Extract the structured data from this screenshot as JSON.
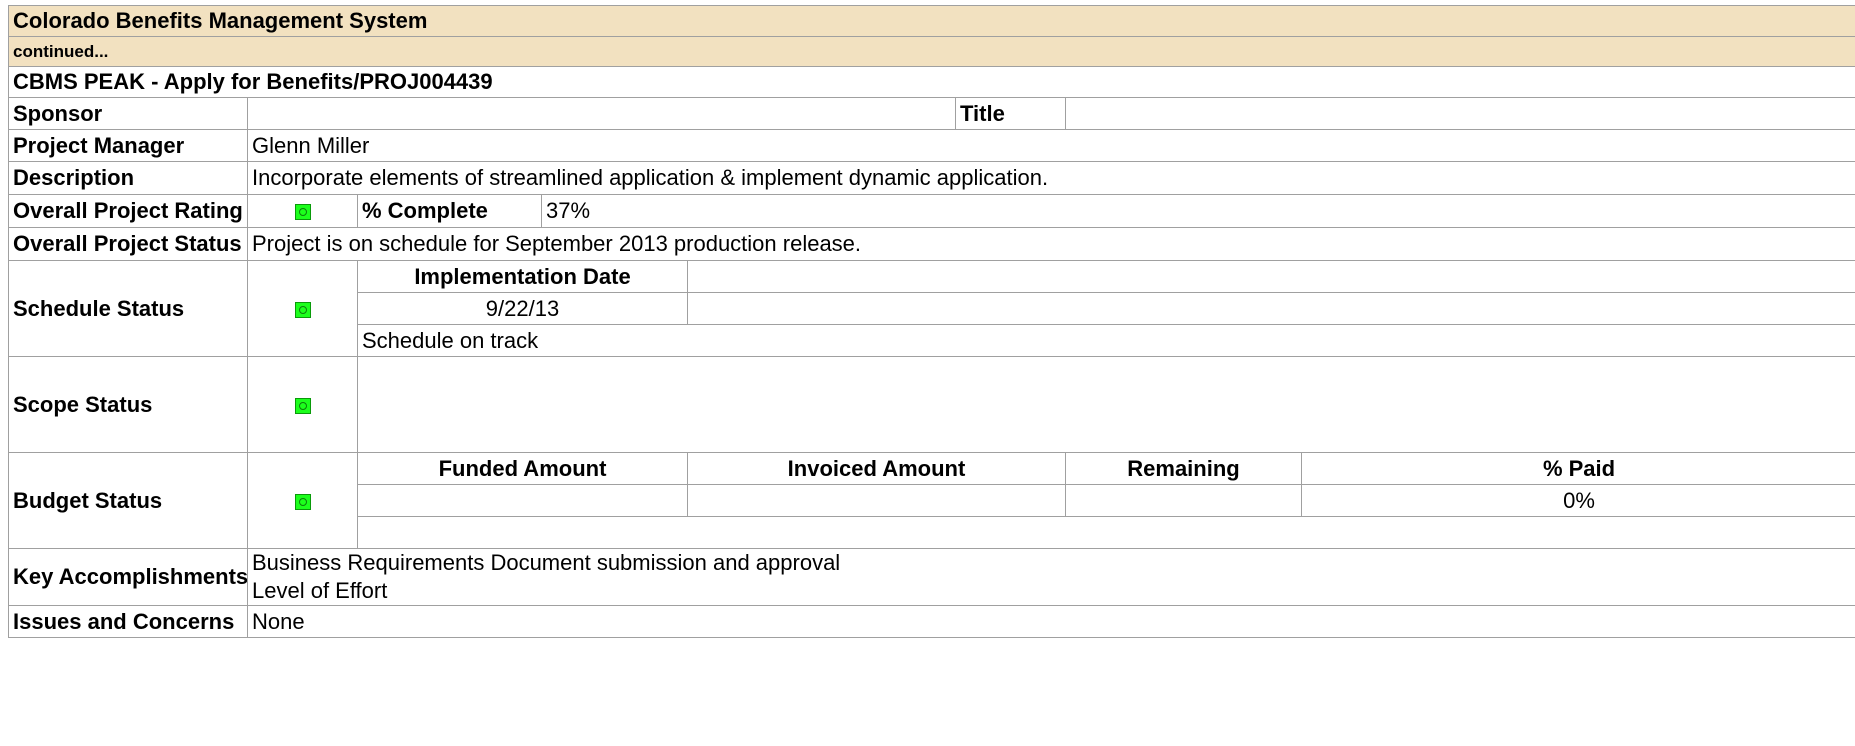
{
  "system_title": "Colorado Benefits Management System",
  "continued": "continued...",
  "project_title": "CBMS PEAK - Apply for Benefits/PROJ004439",
  "labels": {
    "sponsor": "Sponsor",
    "title": "Title",
    "project_manager": "Project Manager",
    "description": "Description",
    "overall_rating": "Overall Project Rating",
    "percent_complete": "% Complete",
    "overall_status": "Overall Project Status",
    "schedule_status": "Schedule Status",
    "implementation_date": "Implementation Date",
    "scope_status": "Scope Status",
    "budget_status": "Budget Status",
    "funded_amount": "Funded Amount",
    "invoiced_amount": "Invoiced Amount",
    "remaining": "Remaining",
    "percent_paid": "% Paid",
    "key_accomplishments": "Key Accomplishments",
    "issues_concerns": "Issues and Concerns"
  },
  "values": {
    "sponsor": "",
    "title": "",
    "project_manager": "Glenn Miller",
    "description": "Incorporate elements of streamlined application & implement dynamic application.",
    "percent_complete": "37%",
    "overall_status": "Project is on schedule for September 2013 production release.",
    "implementation_date": "9/22/13",
    "schedule_note": "Schedule on track",
    "funded_amount": "",
    "invoiced_amount": "",
    "remaining": "",
    "percent_paid": "0%",
    "key_accomplishments": [
      "Business Requirements Document submission and approval",
      "Level of Effort"
    ],
    "issues_concerns": "None"
  },
  "status_indicators": {
    "overall_rating": "green",
    "schedule": "green",
    "scope": "green",
    "budget": "green"
  },
  "colors": {
    "header_band": "#f2e1c0",
    "status_green": "#1cff1c",
    "grid_border": "#a0a0a0"
  }
}
